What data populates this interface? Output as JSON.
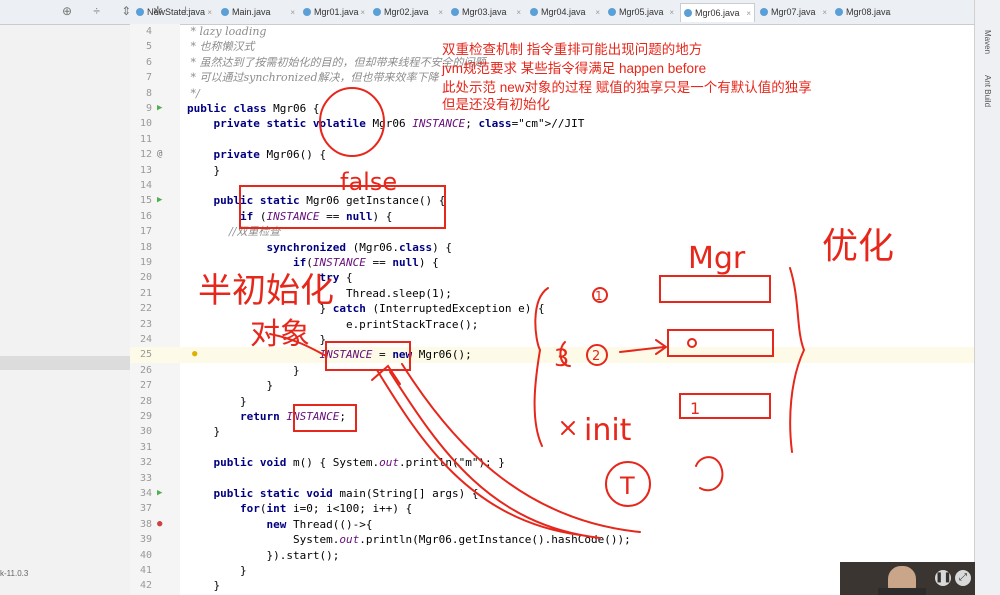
{
  "toolbar_icons": [
    "globe-icon",
    "settings-icon",
    "split-icon",
    "gear-icon",
    "hide-icon"
  ],
  "tabs": [
    "NewState.java",
    "Main.java",
    "Mgr01.java",
    "Mgr02.java",
    "Mgr03.java",
    "Mgr04.java",
    "Mgr05.java",
    "Mgr06.java",
    "Mgr07.java",
    "Mgr08.java"
  ],
  "active_tab": "Mgr06.java",
  "right_strip": [
    "Maven",
    "Ant Build"
  ],
  "jdk_label": "k-11.0.3",
  "code_lines": [
    {
      "n": "4",
      "t": " * lazy loading",
      "c": "comment"
    },
    {
      "n": "5",
      "t": " * 也称懒汉式",
      "c": "comment"
    },
    {
      "n": "6",
      "t": " * 虽然达到了按需初始化的目的，但却带来线程不安全的问题",
      "c": "comment"
    },
    {
      "n": "7",
      "t": " * 可以通过synchronized解决，但也带来效率下降",
      "c": "comment"
    },
    {
      "n": "8",
      "t": " */",
      "c": "comment"
    },
    {
      "n": "9",
      "t": "public class Mgr06 {"
    },
    {
      "n": "10",
      "t": "    private static volatile Mgr06 INSTANCE; //JIT"
    },
    {
      "n": "11",
      "t": ""
    },
    {
      "n": "12",
      "t": "    private Mgr06() {"
    },
    {
      "n": "13",
      "t": "    }"
    },
    {
      "n": "14",
      "t": ""
    },
    {
      "n": "15",
      "t": "    public static Mgr06 getInstance() {"
    },
    {
      "n": "16",
      "t": "        if (INSTANCE == null) {"
    },
    {
      "n": "17",
      "t": "            //双重检查",
      "c": "comment"
    },
    {
      "n": "18",
      "t": "            synchronized (Mgr06.class) {"
    },
    {
      "n": "19",
      "t": "                if(INSTANCE == null) {"
    },
    {
      "n": "20",
      "t": "                    try {"
    },
    {
      "n": "21",
      "t": "                        Thread.sleep(1);"
    },
    {
      "n": "22",
      "t": "                    } catch (InterruptedException e) {"
    },
    {
      "n": "23",
      "t": "                        e.printStackTrace();"
    },
    {
      "n": "24",
      "t": "                    }"
    },
    {
      "n": "25",
      "t": "                    INSTANCE = new Mgr06();"
    },
    {
      "n": "26",
      "t": "                }"
    },
    {
      "n": "27",
      "t": "            }"
    },
    {
      "n": "28",
      "t": "        }"
    },
    {
      "n": "29",
      "t": "        return INSTANCE;"
    },
    {
      "n": "30",
      "t": "    }"
    },
    {
      "n": "31",
      "t": ""
    },
    {
      "n": "32",
      "t": "    public void m() { System.out.println(\"m\"); }"
    },
    {
      "n": "33",
      "t": ""
    },
    {
      "n": "34",
      "t": "    public static void main(String[] args) {"
    },
    {
      "n": "37",
      "t": "        for(int i=0; i<100; i++) {"
    },
    {
      "n": "38",
      "t": "            new Thread(()->{"
    },
    {
      "n": "39",
      "t": "                System.out.println(Mgr06.getInstance().hashCode());"
    },
    {
      "n": "40",
      "t": "            }).start();"
    },
    {
      "n": "41",
      "t": "        }"
    },
    {
      "n": "42",
      "t": "    }"
    }
  ],
  "notes": [
    "双重检查机制 指令重排可能出现问题的地方",
    "jvm规范要求 某些指令得满足 happen before",
    "此处示范 new对象的过程 赋值的独享只是一个有默认值的独享",
    "但是还没有初始化"
  ],
  "handwriting": {
    "false_label": "false",
    "init_label": "半初始化",
    "object_label": "对象",
    "mgr_label": "Mgr",
    "optimize_label": "优化",
    "step1": "1",
    "step2": "2",
    "step3": "3",
    "init_step": "init",
    "t_label": "T"
  },
  "annotation_color": "#e6271b"
}
